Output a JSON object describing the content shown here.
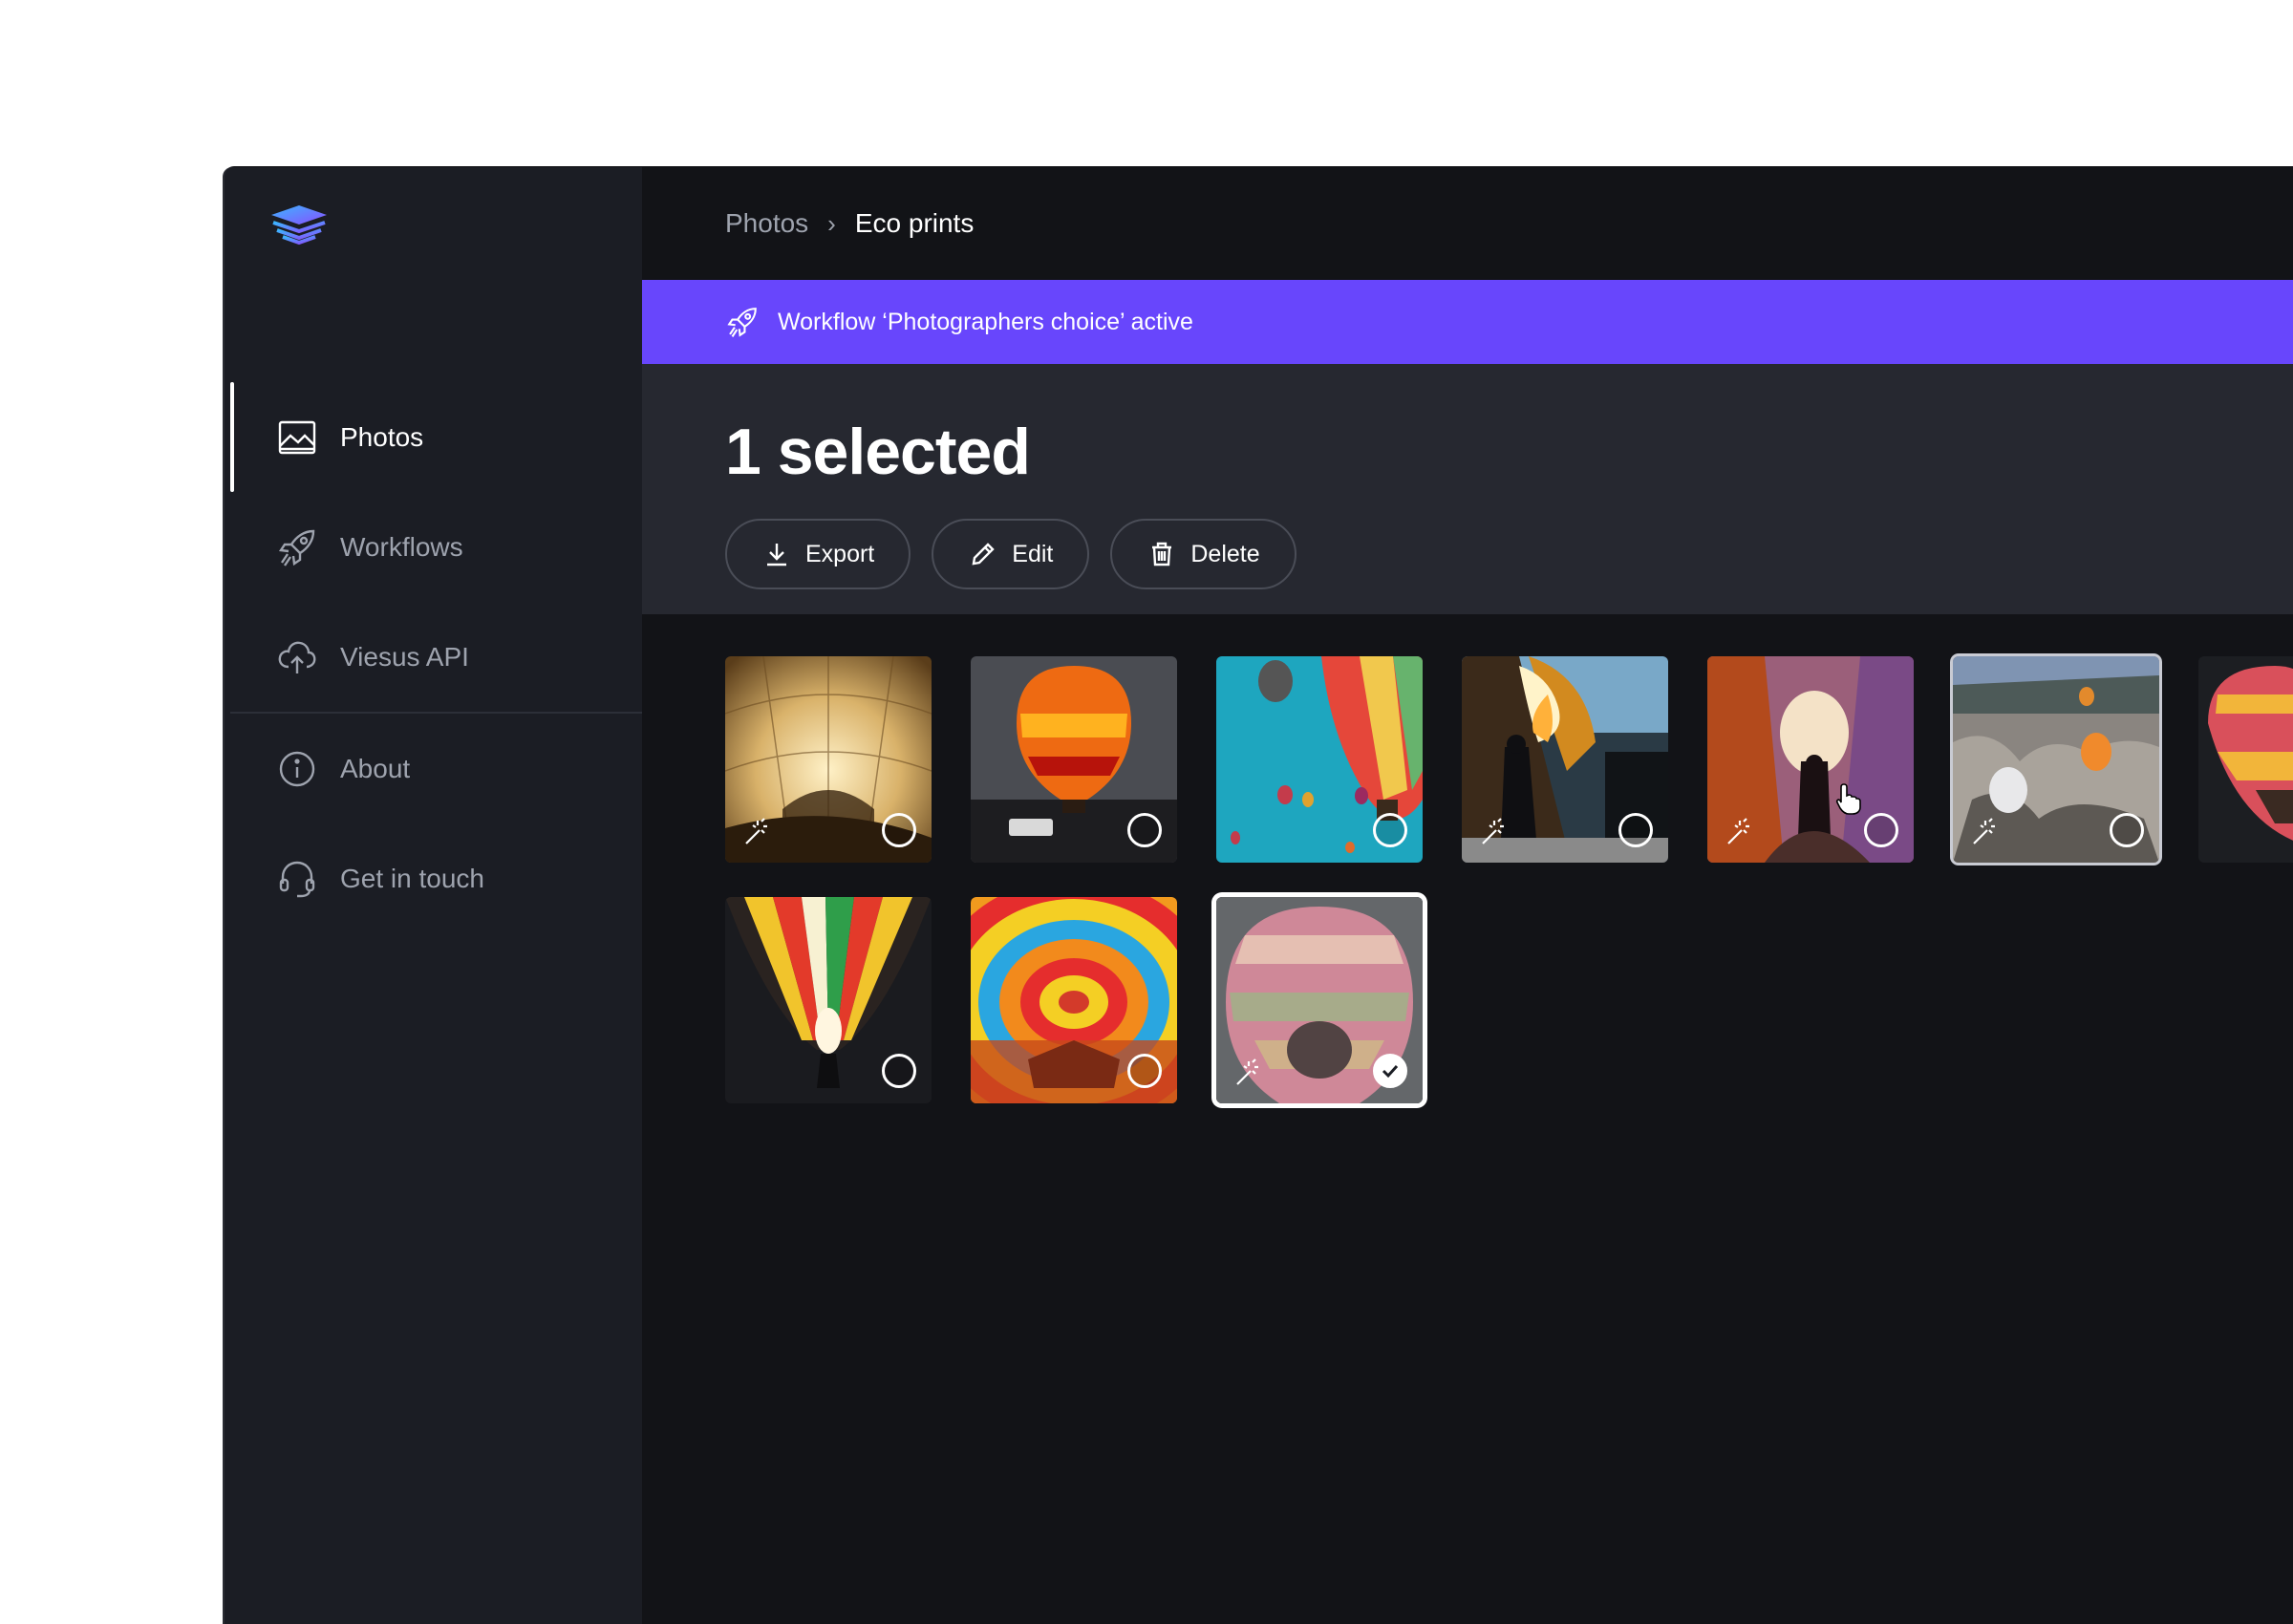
{
  "app": {
    "logo_icon": "layers-logo-icon",
    "accent": "#6846fc",
    "sidebar_bg": "#1b1d24",
    "main_bg": "#121317"
  },
  "sidebar": {
    "items": [
      {
        "label": "Photos",
        "icon": "image-icon",
        "active": true
      },
      {
        "label": "Workflows",
        "icon": "rocket-icon",
        "active": false
      },
      {
        "label": "Viesus API",
        "icon": "cloud-upload-icon",
        "active": false
      },
      {
        "label": "About",
        "icon": "info-icon",
        "active": false
      },
      {
        "label": "Get in touch",
        "icon": "headset-icon",
        "active": false
      }
    ]
  },
  "breadcrumb": {
    "parent": "Photos",
    "separator": "›",
    "current": "Eco prints"
  },
  "banner": {
    "icon": "rocket-icon",
    "text": "Workflow ‘Photographers choice’ active"
  },
  "selection": {
    "title": "1 selected",
    "actions": [
      {
        "label": "Export",
        "icon": "download-icon"
      },
      {
        "label": "Edit",
        "icon": "pencil-icon"
      },
      {
        "label": "Delete",
        "icon": "trash-icon"
      }
    ]
  },
  "photos": [
    {
      "id": 1,
      "subject": "balloon interior canopy",
      "enhanced": true,
      "selected": false
    },
    {
      "id": 2,
      "subject": "orange balloon at dusk",
      "enhanced": false,
      "selected": false
    },
    {
      "id": 3,
      "subject": "balloons against blue sky",
      "enhanced": false,
      "selected": false
    },
    {
      "id": 4,
      "subject": "burner flame",
      "enhanced": true,
      "selected": false
    },
    {
      "id": 5,
      "subject": "person inside balloon envelope",
      "enhanced": true,
      "selected": false
    },
    {
      "id": 6,
      "subject": "balloons over valley",
      "enhanced": true,
      "selected": false,
      "hovered": true
    },
    {
      "id": 7,
      "subject": "balloon partial",
      "enhanced": false,
      "selected": false
    },
    {
      "id": 8,
      "subject": "glowing balloon at night",
      "enhanced": false,
      "selected": false
    },
    {
      "id": 9,
      "subject": "colorful balloon pattern",
      "enhanced": false,
      "selected": false
    },
    {
      "id": 10,
      "subject": "pastel balloon",
      "enhanced": true,
      "selected": true
    }
  ]
}
